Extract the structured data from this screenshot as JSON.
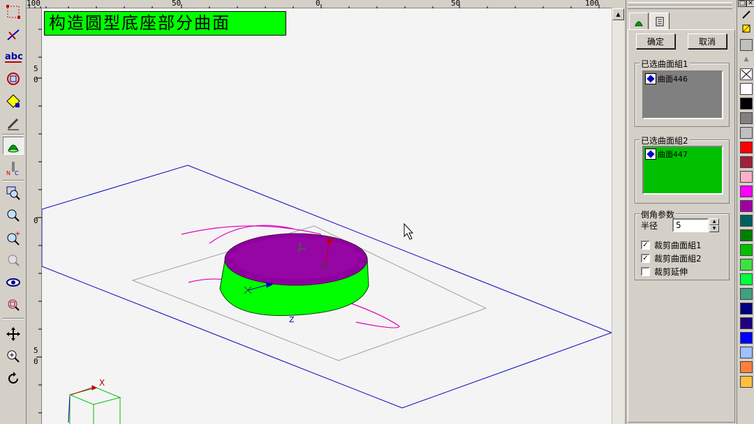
{
  "title_banner": "构造圆型底座部分曲面",
  "ruler": {
    "top": [
      "100",
      "50",
      "0",
      "50",
      "100 mm"
    ],
    "left": [
      "5",
      "0",
      "0",
      "5",
      "0"
    ]
  },
  "panel": {
    "ok_label": "确定",
    "cancel_label": "取消",
    "group1": {
      "title": "已选曲面組1",
      "item": "曲面446",
      "bg": "#808080"
    },
    "group2": {
      "title": "已选曲面組2",
      "item": "曲面447",
      "bg": "#00c000"
    },
    "params": {
      "title": "倒角参数",
      "radius_label": "半径",
      "radius_value": "5",
      "checks": [
        {
          "label": "裁剪曲面組1",
          "checked": true
        },
        {
          "label": "裁剪曲面組2",
          "checked": true
        },
        {
          "label": "裁剪延伸",
          "checked": false
        }
      ]
    }
  },
  "palette": {
    "colors": [
      "#ffffff",
      "#000000",
      "#808080",
      "#c0c0c0",
      "#ff0000",
      "#a0203c",
      "#ffb0c8",
      "#ff00ff",
      "#a000a0",
      "#006060",
      "#008000",
      "#00c000",
      "#40e040",
      "#00ff40",
      "#40a080",
      "#000080",
      "#200080",
      "#0000ff",
      "#a0c0ff",
      "#ff8040",
      "#ffc040"
    ]
  },
  "toolbar_icons": [
    "select-box-icon",
    "line-tool-icon",
    "text-abc-icon",
    "circle-tool-icon",
    "shape-edit-icon",
    "pen-icon",
    "surface-icon",
    "nc-icon",
    "zoom-window-icon",
    "zoom-out-icon",
    "zoom-in-icon",
    "zoom-prev-icon",
    "view-eye-icon",
    "zoom-fit-icon",
    "pan-icon",
    "zoom-realtime-icon",
    "rotate-icon"
  ]
}
